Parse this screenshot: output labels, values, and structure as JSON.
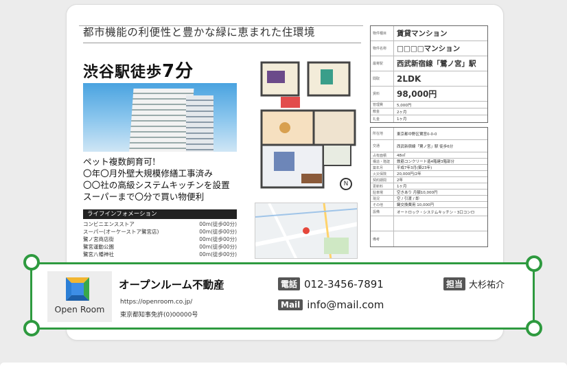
{
  "flyer": {
    "headline": "都市機能の利便性と豊かな緑に恵まれた住環境",
    "station_prefix": "渋谷駅徒歩",
    "station_minutes": "7分",
    "features": [
      "ペット複数飼育可!",
      "〇年〇月外壁大規模修繕工事済み",
      "〇〇社の高級システムキッチンを設置",
      "スーパーまで〇分で買い物便利"
    ],
    "lifeinfo_title": "ライフインフォメーション",
    "lifeinfo": [
      {
        "name": "コンビニエンスストア",
        "dist": "00m(徒歩00分)"
      },
      {
        "name": "スーパー(オーケーストア鷺宮店)",
        "dist": "00m(徒歩00分)"
      },
      {
        "name": "鷺ノ宮商店街",
        "dist": "00m(徒歩00分)"
      },
      {
        "name": "鷺宮運動公園",
        "dist": "00m(徒歩00分)"
      },
      {
        "name": "鷺宮八幡神社",
        "dist": "00m(徒歩00分)"
      }
    ],
    "compass": "N",
    "specs_top": [
      {
        "k": "物件種目",
        "v": "賃貸マンション"
      },
      {
        "k": "物件名称",
        "v": "□□□□マンション"
      },
      {
        "k": "最寄駅",
        "v": "西武新宿線「鷺ノ宮」駅"
      },
      {
        "k": "間取",
        "v": "2LDK"
      },
      {
        "k": "賃料",
        "v": "98,000円"
      },
      {
        "k": "管理費",
        "v": "5,000円"
      },
      {
        "k": "敷金",
        "v": "2ヶ月"
      },
      {
        "k": "礼金",
        "v": "1ヶ月"
      }
    ],
    "specs_bottom": [
      {
        "k": "所在地",
        "v": "東京都中野区鷺宮0-0-0"
      },
      {
        "k": "交通",
        "v": "西武新宿線「鷺ノ宮」駅 徒歩6分"
      },
      {
        "k": "占有面積",
        "v": "48㎡"
      },
      {
        "k": "構造・階建",
        "v": "鉄筋コンクリート造4階建3階部分"
      },
      {
        "k": "築年月",
        "v": "平成7年3月(築23年)"
      },
      {
        "k": "火災保険",
        "v": "20,000円/2年"
      },
      {
        "k": "契約期間",
        "v": "2年"
      },
      {
        "k": "更新料",
        "v": "1ヶ月"
      },
      {
        "k": "駐車場",
        "v": "空きあり 月額10,000円"
      },
      {
        "k": "現況",
        "v": "空 / 引渡 / 即"
      },
      {
        "k": "その他",
        "v": "鍵交換費用 10,000円"
      },
      {
        "k": "設備",
        "v": "オートロック・システムキッチン・3口コンロ"
      },
      {
        "k": "",
        "v": ""
      },
      {
        "k": "備考",
        "v": ""
      }
    ]
  },
  "agency": {
    "logo_text": "Open Room",
    "company": "オープンルーム不動産",
    "url": "https://openroom.co.jp/",
    "license": "東京都知事免許(0)00000号",
    "phone_tag": "電話",
    "phone": "012-3456-7891",
    "mail_tag": "Mail",
    "email": "info@mail.com",
    "staff_tag": "担当",
    "staff_name": "大杉祐介"
  },
  "colors": {
    "frame": "#2e9a3f",
    "tag_bg": "#555555",
    "logo_blue": "#2b7fd6",
    "logo_yellow": "#f2b631",
    "logo_green": "#39a84a"
  }
}
